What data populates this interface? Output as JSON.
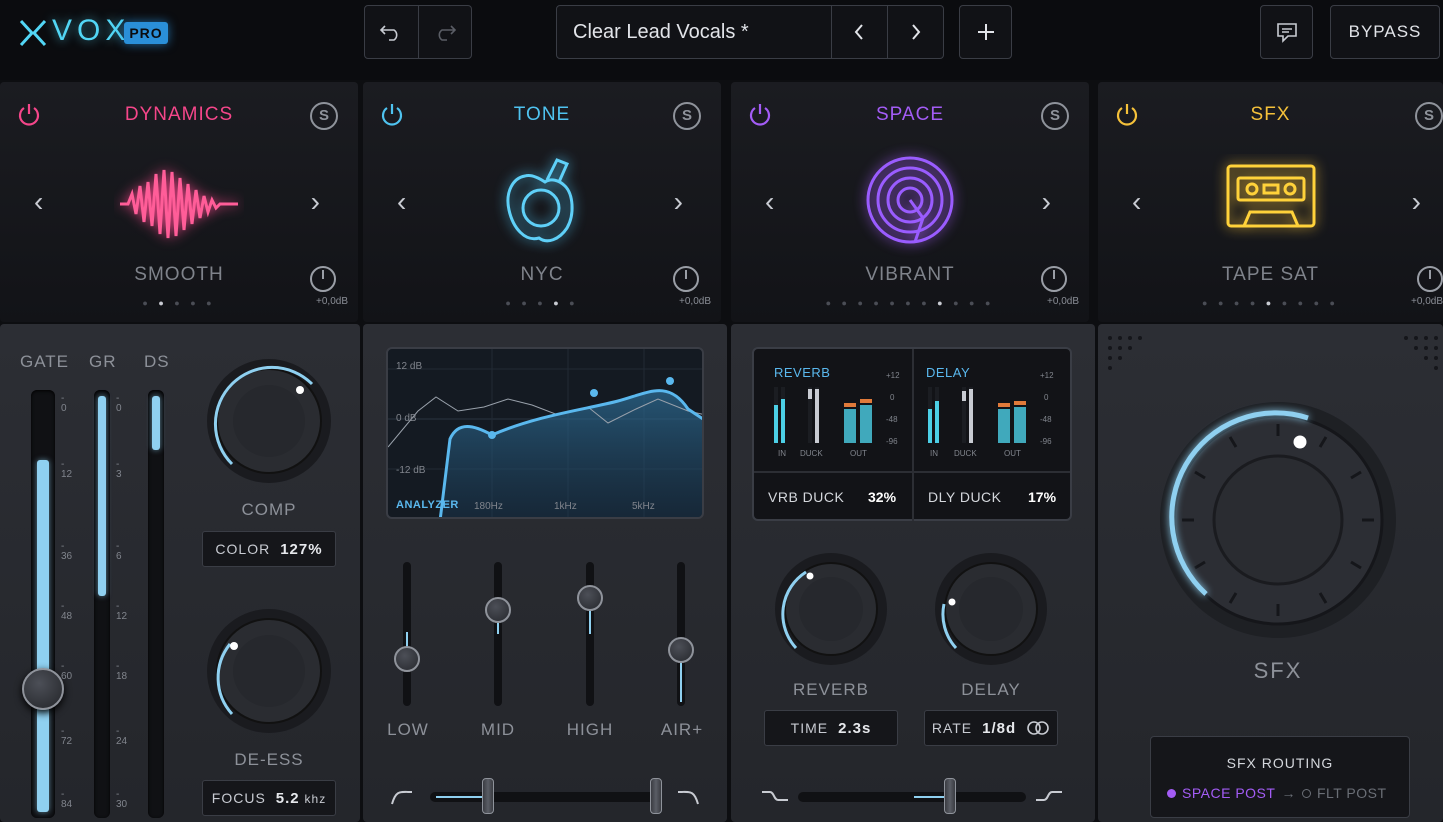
{
  "app": {
    "logo_text": "VOX",
    "logo_badge": "PRO",
    "brand_color": "#52d6f5"
  },
  "toolbar": {
    "undo_icon": "undo-icon",
    "redo_icon": "redo-icon",
    "preset_name": "Clear Lead Vocals *",
    "prev_icon": "chevron-left-icon",
    "next_icon": "chevron-right-icon",
    "add_icon": "plus-icon",
    "feedback_icon": "chat-icon",
    "bypass_label": "BYPASS"
  },
  "modules": [
    {
      "title": "DYNAMICS",
      "color": "#f5468a",
      "preset": "SMOOTH",
      "gain": "+0,0dB",
      "icon": "waveform-icon"
    },
    {
      "title": "TONE",
      "color": "#4fc3f0",
      "preset": "NYC",
      "gain": "+0,0dB",
      "icon": "apple-icon"
    },
    {
      "title": "SPACE",
      "color": "#a35cf5",
      "preset": "VIBRANT",
      "gain": "+0,0dB",
      "icon": "spiral-icon"
    },
    {
      "title": "SFX",
      "color": "#f5c13a",
      "preset": "TAPE SAT",
      "gain": "+0,0dB",
      "icon": "cassette-icon"
    }
  ],
  "module_solo_label": "S",
  "dynamics": {
    "meters": {
      "gate": "GATE",
      "gr": "GR",
      "ds": "DS"
    },
    "gate_scale": [
      "- 0",
      "- 12",
      "- 36",
      "- 48",
      "- 60",
      "- 72",
      "- 84"
    ],
    "gr_scale": [
      "- 0",
      "- 3",
      "- 6",
      "- 12",
      "- 18",
      "- 24",
      "- 30"
    ],
    "comp_label": "COMP",
    "color_label": "COLOR",
    "color_value": "127%",
    "deess_label": "DE-ESS",
    "focus_label": "FOCUS",
    "focus_value": "5.2",
    "focus_unit": "khz"
  },
  "tone": {
    "db_labels": [
      "12 dB",
      "0 dB",
      "-12 dB"
    ],
    "analyzer_label": "ANALYZER",
    "freq_labels": [
      "180Hz",
      "1kHz",
      "5kHz"
    ],
    "bands": [
      "LOW",
      "MID",
      "HIGH",
      "AIR+"
    ]
  },
  "space": {
    "reverb_title": "REVERB",
    "delay_title": "DELAY",
    "meter_labels": [
      "IN",
      "DUCK",
      "OUT"
    ],
    "meter_scale": [
      "+12",
      "0",
      "-48",
      "-96"
    ],
    "vrb_duck_label": "VRB DUCK",
    "vrb_duck_value": "32%",
    "dly_duck_label": "DLY DUCK",
    "dly_duck_value": "17%",
    "reverb_label": "REVERB",
    "delay_label": "DELAY",
    "time_label": "TIME",
    "time_value": "2.3s",
    "rate_label": "RATE",
    "rate_value": "1/8d"
  },
  "sfx": {
    "knob_label": "SFX",
    "routing_title": "SFX ROUTING",
    "routing_active": "SPACE POST",
    "routing_inactive": "FLT POST"
  }
}
